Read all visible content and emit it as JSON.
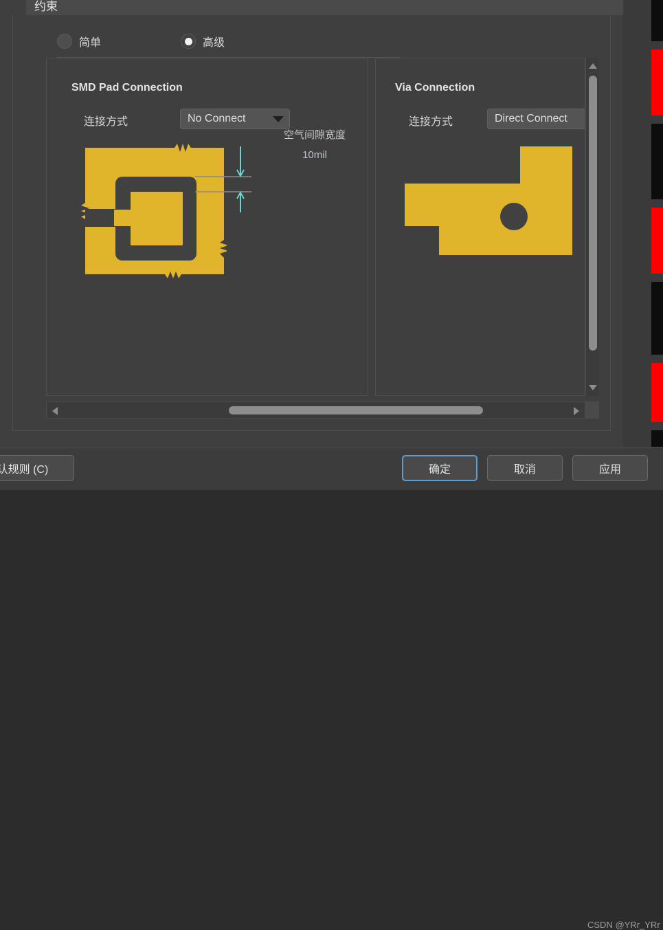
{
  "window": {
    "tab_label": "约束"
  },
  "mode_selector": {
    "options": [
      {
        "label": "简单",
        "selected": false
      },
      {
        "label": "高级",
        "selected": true
      }
    ]
  },
  "smd_group": {
    "title": "SMD Pad Connection",
    "connection_label": "连接方式",
    "connection_value": "No Connect",
    "air_gap_title": "空气间隙宽度",
    "air_gap_value": "10mil"
  },
  "via_group": {
    "title": "Via Connection",
    "connection_label": "连接方式",
    "connection_value": "Direct Connect"
  },
  "footer": {
    "default_rules_label": "认规则 (C)",
    "ok_label": "确定",
    "cancel_label": "取消",
    "apply_label": "应用"
  },
  "watermark": {
    "text": "CSDN @YRr_YRr"
  },
  "colors": {
    "copper_yellow": "#E0B52C",
    "background_dark": "#3f3f3f",
    "plane_dark": "#414141",
    "accent_blue": "#5a9fd4",
    "dimension_teal": "#6fd2cc",
    "strip_red": "#ff0000"
  }
}
